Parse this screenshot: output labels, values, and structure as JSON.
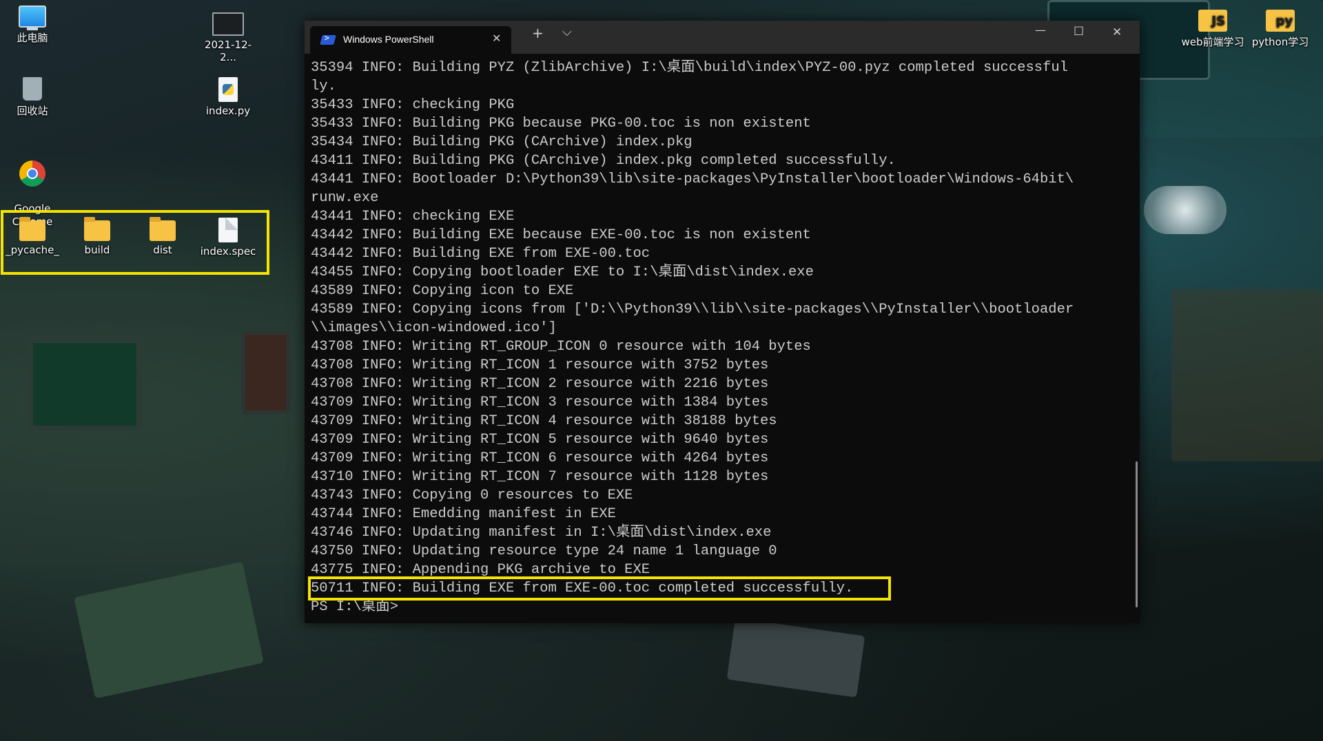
{
  "desktop": {
    "icons": [
      {
        "label": "此电脑",
        "icon": "computer-icon"
      },
      {
        "label": "2021-12-2...",
        "icon": "video-file-icon"
      },
      {
        "label": "回收站",
        "icon": "recycle-bin-icon"
      },
      {
        "label": "index.py",
        "icon": "python-file-icon"
      },
      {
        "label": "Google\nChrome",
        "icon": "chrome-icon"
      },
      {
        "label": "_pycache_",
        "icon": "folder-icon"
      },
      {
        "label": "build",
        "icon": "folder-icon"
      },
      {
        "label": "dist",
        "icon": "folder-icon"
      },
      {
        "label": "index.spec",
        "icon": "file-icon"
      },
      {
        "label": "web前端学习",
        "icon": "js-folder-icon"
      },
      {
        "label": "python学习",
        "icon": "python-folder-icon"
      }
    ],
    "js_badge": "JS",
    "py_badge": "py",
    "highlight_color": "#f4e500"
  },
  "terminal": {
    "tab_title": "Windows PowerShell",
    "close_tab": "✕",
    "new_tab": "+",
    "dropdown": "⌵",
    "minimize": "—",
    "maximize": "☐",
    "close_window": "✕",
    "lines": [
      "35394 INFO: Building PYZ (ZlibArchive) I:\\桌面\\build\\index\\PYZ-00.pyz completed successful",
      "ly.",
      "35433 INFO: checking PKG",
      "35433 INFO: Building PKG because PKG-00.toc is non existent",
      "35434 INFO: Building PKG (CArchive) index.pkg",
      "43411 INFO: Building PKG (CArchive) index.pkg completed successfully.",
      "43441 INFO: Bootloader D:\\Python39\\lib\\site-packages\\PyInstaller\\bootloader\\Windows-64bit\\",
      "runw.exe",
      "43441 INFO: checking EXE",
      "43442 INFO: Building EXE because EXE-00.toc is non existent",
      "43442 INFO: Building EXE from EXE-00.toc",
      "43455 INFO: Copying bootloader EXE to I:\\桌面\\dist\\index.exe",
      "43589 INFO: Copying icon to EXE",
      "43589 INFO: Copying icons from ['D:\\\\Python39\\\\lib\\\\site-packages\\\\PyInstaller\\\\bootloader",
      "\\\\images\\\\icon-windowed.ico']",
      "43708 INFO: Writing RT_GROUP_ICON 0 resource with 104 bytes",
      "43708 INFO: Writing RT_ICON 1 resource with 3752 bytes",
      "43708 INFO: Writing RT_ICON 2 resource with 2216 bytes",
      "43709 INFO: Writing RT_ICON 3 resource with 1384 bytes",
      "43709 INFO: Writing RT_ICON 4 resource with 38188 bytes",
      "43709 INFO: Writing RT_ICON 5 resource with 9640 bytes",
      "43709 INFO: Writing RT_ICON 6 resource with 4264 bytes",
      "43710 INFO: Writing RT_ICON 7 resource with 1128 bytes",
      "43743 INFO: Copying 0 resources to EXE",
      "43744 INFO: Emedding manifest in EXE",
      "43746 INFO: Updating manifest in I:\\桌面\\dist\\index.exe",
      "43750 INFO: Updating resource type 24 name 1 language 0",
      "43775 INFO: Appending PKG archive to EXE",
      "50711 INFO: Building EXE from EXE-00.toc completed successfully.",
      "PS I:\\桌面>"
    ],
    "highlighted_line_index": 28
  }
}
